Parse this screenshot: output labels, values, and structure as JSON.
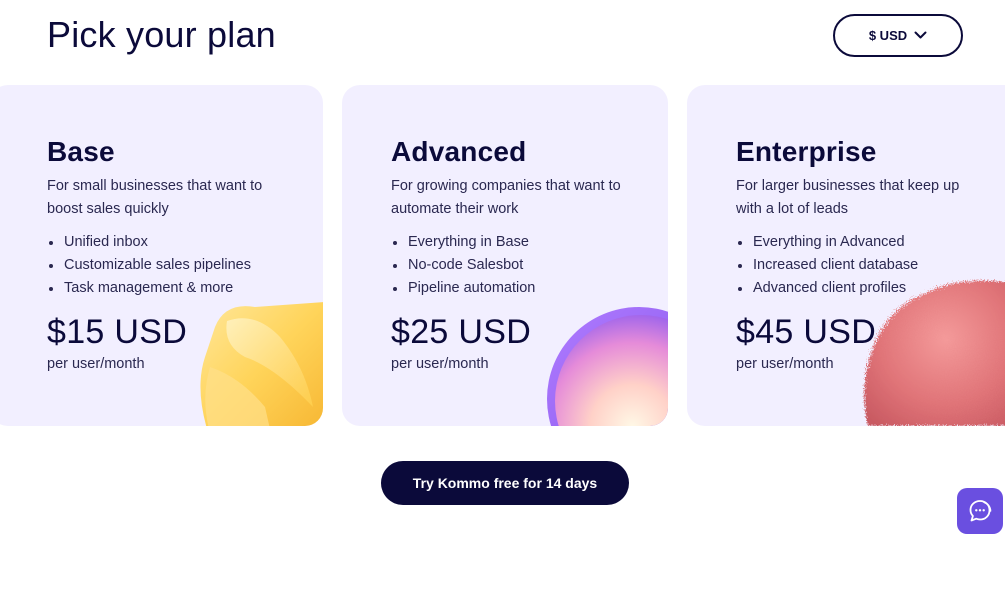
{
  "header": {
    "title": "Pick your plan",
    "currency": "$ USD"
  },
  "plans": [
    {
      "name": "Base",
      "description": "For small businesses that want to boost sales quickly",
      "features": [
        "Unified inbox",
        "Customizable sales pipelines",
        "Task management & more"
      ],
      "price": "$15 USD",
      "period": "per user/month"
    },
    {
      "name": "Advanced",
      "description": "For growing companies that want to automate their work",
      "features": [
        "Everything in Base",
        "No-code Salesbot",
        "Pipeline automation"
      ],
      "price": "$25 USD",
      "period": "per user/month"
    },
    {
      "name": "Enterprise",
      "description": "For larger businesses that keep up with a lot of leads",
      "features": [
        "Everything in Advanced",
        "Increased client database",
        "Advanced client profiles"
      ],
      "price": "$45 USD",
      "period": "per user/month"
    }
  ],
  "cta": {
    "label": "Try Kommo free for 14 days"
  },
  "colors": {
    "text": "#0b0a3a",
    "card_bg": "#f2efff",
    "accent": "#6a4fe0"
  },
  "icons": {
    "currency_dropdown": "chevron-down-icon",
    "chat": "chat-bubble-icon"
  }
}
